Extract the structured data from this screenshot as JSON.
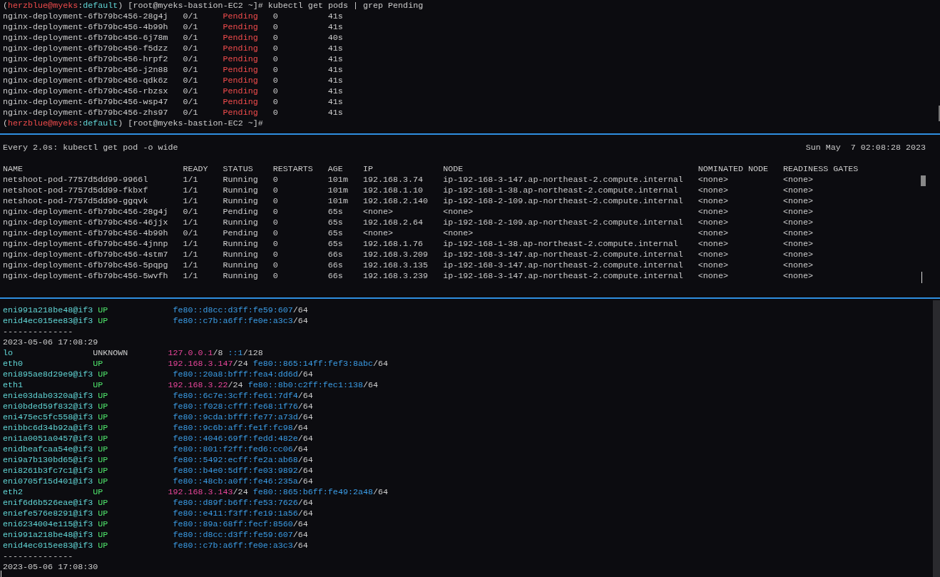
{
  "panes": [
    {
      "kind": "shell",
      "prompt": [
        {
          "text": "(",
          "kind": "plain"
        },
        {
          "text": "herzblue@myeks",
          "kind": "user"
        },
        {
          "text": ":",
          "kind": "plain"
        },
        {
          "text": "default",
          "kind": "context"
        },
        {
          "text": ")",
          "kind": "plain"
        },
        {
          "text": " [root@myeks-bastion-EC2 ~]# kubectl get pods | grep Pending",
          "kind": "plain"
        }
      ],
      "rows": [
        [
          "nginx-deployment-6fb79bc456-28g4j",
          "0/1",
          "Pending",
          "0",
          "41s"
        ],
        [
          "nginx-deployment-6fb79bc456-4b99h",
          "0/1",
          "Pending",
          "0",
          "41s"
        ],
        [
          "nginx-deployment-6fb79bc456-6j78m",
          "0/1",
          "Pending",
          "0",
          "40s"
        ],
        [
          "nginx-deployment-6fb79bc456-f5dzz",
          "0/1",
          "Pending",
          "0",
          "41s"
        ],
        [
          "nginx-deployment-6fb79bc456-hrpf2",
          "0/1",
          "Pending",
          "0",
          "41s"
        ],
        [
          "nginx-deployment-6fb79bc456-j2n88",
          "0/1",
          "Pending",
          "0",
          "41s"
        ],
        [
          "nginx-deployment-6fb79bc456-qdk6z",
          "0/1",
          "Pending",
          "0",
          "41s"
        ],
        [
          "nginx-deployment-6fb79bc456-rbzsx",
          "0/1",
          "Pending",
          "0",
          "41s"
        ],
        [
          "nginx-deployment-6fb79bc456-wsp47",
          "0/1",
          "Pending",
          "0",
          "41s"
        ],
        [
          "nginx-deployment-6fb79bc456-zhs97",
          "0/1",
          "Pending",
          "0",
          "41s"
        ]
      ],
      "prompt_after": [
        {
          "text": "(",
          "kind": "plain"
        },
        {
          "text": "herzblue@myeks",
          "kind": "user"
        },
        {
          "text": ":",
          "kind": "plain"
        },
        {
          "text": "default",
          "kind": "context"
        },
        {
          "text": ")",
          "kind": "plain"
        },
        {
          "text": " [root@myeks-bastion-EC2 ~]#",
          "kind": "plain"
        }
      ]
    },
    {
      "kind": "watch",
      "command": "Every 2.0s: kubectl get pod -o wide",
      "timestamp": "Sun May  7 02:08:28 2023",
      "columns": [
        "NAME",
        "READY",
        "STATUS",
        "RESTARTS",
        "AGE",
        "IP",
        "NODE",
        "NOMINATED NODE",
        "READINESS GATES"
      ],
      "rows": [
        [
          "netshoot-pod-7757d5dd99-9966l",
          "1/1",
          "Running",
          "0",
          "101m",
          "192.168.3.74",
          "ip-192-168-3-147.ap-northeast-2.compute.internal",
          "<none>",
          "<none>"
        ],
        [
          "netshoot-pod-7757d5dd99-fkbxf",
          "1/1",
          "Running",
          "0",
          "101m",
          "192.168.1.10",
          "ip-192-168-1-38.ap-northeast-2.compute.internal",
          "<none>",
          "<none>"
        ],
        [
          "netshoot-pod-7757d5dd99-ggqvk",
          "1/1",
          "Running",
          "0",
          "101m",
          "192.168.2.140",
          "ip-192-168-2-109.ap-northeast-2.compute.internal",
          "<none>",
          "<none>"
        ],
        [
          "nginx-deployment-6fb79bc456-28g4j",
          "0/1",
          "Pending",
          "0",
          "65s",
          "<none>",
          "<none>",
          "<none>",
          "<none>"
        ],
        [
          "nginx-deployment-6fb79bc456-46jjx",
          "1/1",
          "Running",
          "0",
          "65s",
          "192.168.2.64",
          "ip-192-168-2-109.ap-northeast-2.compute.internal",
          "<none>",
          "<none>"
        ],
        [
          "nginx-deployment-6fb79bc456-4b99h",
          "0/1",
          "Pending",
          "0",
          "65s",
          "<none>",
          "<none>",
          "<none>",
          "<none>"
        ],
        [
          "nginx-deployment-6fb79bc456-4jnnp",
          "1/1",
          "Running",
          "0",
          "65s",
          "192.168.1.76",
          "ip-192-168-1-38.ap-northeast-2.compute.internal",
          "<none>",
          "<none>"
        ],
        [
          "nginx-deployment-6fb79bc456-4stm7",
          "1/1",
          "Running",
          "0",
          "66s",
          "192.168.3.209",
          "ip-192-168-3-147.ap-northeast-2.compute.internal",
          "<none>",
          "<none>"
        ],
        [
          "nginx-deployment-6fb79bc456-5pqpg",
          "1/1",
          "Running",
          "0",
          "66s",
          "192.168.3.135",
          "ip-192-168-3-147.ap-northeast-2.compute.internal",
          "<none>",
          "<none>"
        ],
        [
          "nginx-deployment-6fb79bc456-5wvfh",
          "1/1",
          "Running",
          "0",
          "66s",
          "192.168.3.239",
          "ip-192-168-3-147.ap-northeast-2.compute.internal",
          "<none>",
          "<none>"
        ]
      ]
    },
    {
      "kind": "log",
      "lines": [
        {
          "kind": "iface",
          "name": "eni991a218be48@if3",
          "state": {
            "text": "UP",
            "kind": "up"
          },
          "addresses": [
            {
              "ip": "fe80::d8cc:d3ff:fe59:607",
              "prefix": "/64",
              "kind": "v6"
            }
          ]
        },
        {
          "kind": "iface",
          "name": "enid4ec015ee83@if3",
          "state": {
            "text": "UP",
            "kind": "up"
          },
          "addresses": [
            {
              "ip": "fe80::c7b:a6ff:fe0e:a3c3",
              "prefix": "/64",
              "kind": "v6"
            }
          ]
        },
        {
          "kind": "separator",
          "text": "--------------"
        },
        {
          "kind": "timestamp",
          "text": "2023-05-06 17:08:29"
        },
        {
          "kind": "iface",
          "name": "lo",
          "state": {
            "text": "UNKNOWN",
            "kind": "unknown"
          },
          "addresses": [
            {
              "ip": "127.0.0.1",
              "prefix": "/8",
              "kind": "v4"
            },
            {
              "ip": "::1",
              "prefix": "/128",
              "kind": "v6"
            }
          ]
        },
        {
          "kind": "iface",
          "name": "eth0",
          "state": {
            "text": "UP",
            "kind": "up"
          },
          "addresses": [
            {
              "ip": "192.168.3.147",
              "prefix": "/24",
              "kind": "v4"
            },
            {
              "ip": "fe80::865:14ff:fef3:8abc",
              "prefix": "/64",
              "kind": "v6"
            }
          ]
        },
        {
          "kind": "iface",
          "name": "eni895ae8d29e9@if3",
          "state": {
            "text": "UP",
            "kind": "up"
          },
          "addresses": [
            {
              "ip": "fe80::20a8:bfff:fea4:dd6d",
              "prefix": "/64",
              "kind": "v6"
            }
          ]
        },
        {
          "kind": "iface",
          "name": "eth1",
          "state": {
            "text": "UP",
            "kind": "up"
          },
          "addresses": [
            {
              "ip": "192.168.3.22",
              "prefix": "/24",
              "kind": "v4"
            },
            {
              "ip": "fe80::8b0:c2ff:fec1:138",
              "prefix": "/64",
              "kind": "v6"
            }
          ]
        },
        {
          "kind": "iface",
          "name": "enie03dab0320a@if3",
          "state": {
            "text": "UP",
            "kind": "up"
          },
          "addresses": [
            {
              "ip": "fe80::6c7e:3cff:fe61:7df4",
              "prefix": "/64",
              "kind": "v6"
            }
          ]
        },
        {
          "kind": "iface",
          "name": "eni0bded59f832@if3",
          "state": {
            "text": "UP",
            "kind": "up"
          },
          "addresses": [
            {
              "ip": "fe80::f028:cfff:fe68:1f76",
              "prefix": "/64",
              "kind": "v6"
            }
          ]
        },
        {
          "kind": "iface",
          "name": "eni475ec5fc558@if3",
          "state": {
            "text": "UP",
            "kind": "up"
          },
          "addresses": [
            {
              "ip": "fe80::9cda:bfff:fe77:a73d",
              "prefix": "/64",
              "kind": "v6"
            }
          ]
        },
        {
          "kind": "iface",
          "name": "enibbc6d34b92a@if3",
          "state": {
            "text": "UP",
            "kind": "up"
          },
          "addresses": [
            {
              "ip": "fe80::9c6b:aff:fe1f:fc98",
              "prefix": "/64",
              "kind": "v6"
            }
          ]
        },
        {
          "kind": "iface",
          "name": "eni1a0051a0457@if3",
          "state": {
            "text": "UP",
            "kind": "up"
          },
          "addresses": [
            {
              "ip": "fe80::4046:69ff:fedd:482e",
              "prefix": "/64",
              "kind": "v6"
            }
          ]
        },
        {
          "kind": "iface",
          "name": "enidbeafcaa54e@if3",
          "state": {
            "text": "UP",
            "kind": "up"
          },
          "addresses": [
            {
              "ip": "fe80::801:f2ff:fed6:cc06",
              "prefix": "/64",
              "kind": "v6"
            }
          ]
        },
        {
          "kind": "iface",
          "name": "eni9a7b130bd65@if3",
          "state": {
            "text": "UP",
            "kind": "up"
          },
          "addresses": [
            {
              "ip": "fe80::5492:ecff:fe2a:ab68",
              "prefix": "/64",
              "kind": "v6"
            }
          ]
        },
        {
          "kind": "iface",
          "name": "eni8261b3fc7c1@if3",
          "state": {
            "text": "UP",
            "kind": "up"
          },
          "addresses": [
            {
              "ip": "fe80::b4e0:5dff:fe03:9892",
              "prefix": "/64",
              "kind": "v6"
            }
          ]
        },
        {
          "kind": "iface",
          "name": "eni0705f15d401@if3",
          "state": {
            "text": "UP",
            "kind": "up"
          },
          "addresses": [
            {
              "ip": "fe80::48cb:a0ff:fe46:235a",
              "prefix": "/64",
              "kind": "v6"
            }
          ]
        },
        {
          "kind": "iface",
          "name": "eth2",
          "state": {
            "text": "UP",
            "kind": "up"
          },
          "addresses": [
            {
              "ip": "192.168.3.143",
              "prefix": "/24",
              "kind": "v4"
            },
            {
              "ip": "fe80::865:b6ff:fe49:2a48",
              "prefix": "/64",
              "kind": "v6"
            }
          ]
        },
        {
          "kind": "iface",
          "name": "enif6d6b526eae@if3",
          "state": {
            "text": "UP",
            "kind": "up"
          },
          "addresses": [
            {
              "ip": "fe80::d89f:b6ff:fe53:7626",
              "prefix": "/64",
              "kind": "v6"
            }
          ]
        },
        {
          "kind": "iface",
          "name": "eniefe576e8291@if3",
          "state": {
            "text": "UP",
            "kind": "up"
          },
          "addresses": [
            {
              "ip": "fe80::e411:f3ff:fe19:1a56",
              "prefix": "/64",
              "kind": "v6"
            }
          ]
        },
        {
          "kind": "iface",
          "name": "eni6234004e115@if3",
          "state": {
            "text": "UP",
            "kind": "up"
          },
          "addresses": [
            {
              "ip": "fe80::89a:68ff:fecf:8560",
              "prefix": "/64",
              "kind": "v6"
            }
          ]
        },
        {
          "kind": "iface",
          "name": "eni991a218be48@if3",
          "state": {
            "text": "UP",
            "kind": "up"
          },
          "addresses": [
            {
              "ip": "fe80::d8cc:d3ff:fe59:607",
              "prefix": "/64",
              "kind": "v6"
            }
          ]
        },
        {
          "kind": "iface",
          "name": "enid4ec015ee83@if3",
          "state": {
            "text": "UP",
            "kind": "up"
          },
          "addresses": [
            {
              "ip": "fe80::c7b:a6ff:fe0e:a3c3",
              "prefix": "/64",
              "kind": "v6"
            }
          ]
        },
        {
          "kind": "separator",
          "text": "--------------"
        },
        {
          "kind": "timestamp",
          "text": "2023-05-06 17:08:30"
        }
      ]
    }
  ]
}
